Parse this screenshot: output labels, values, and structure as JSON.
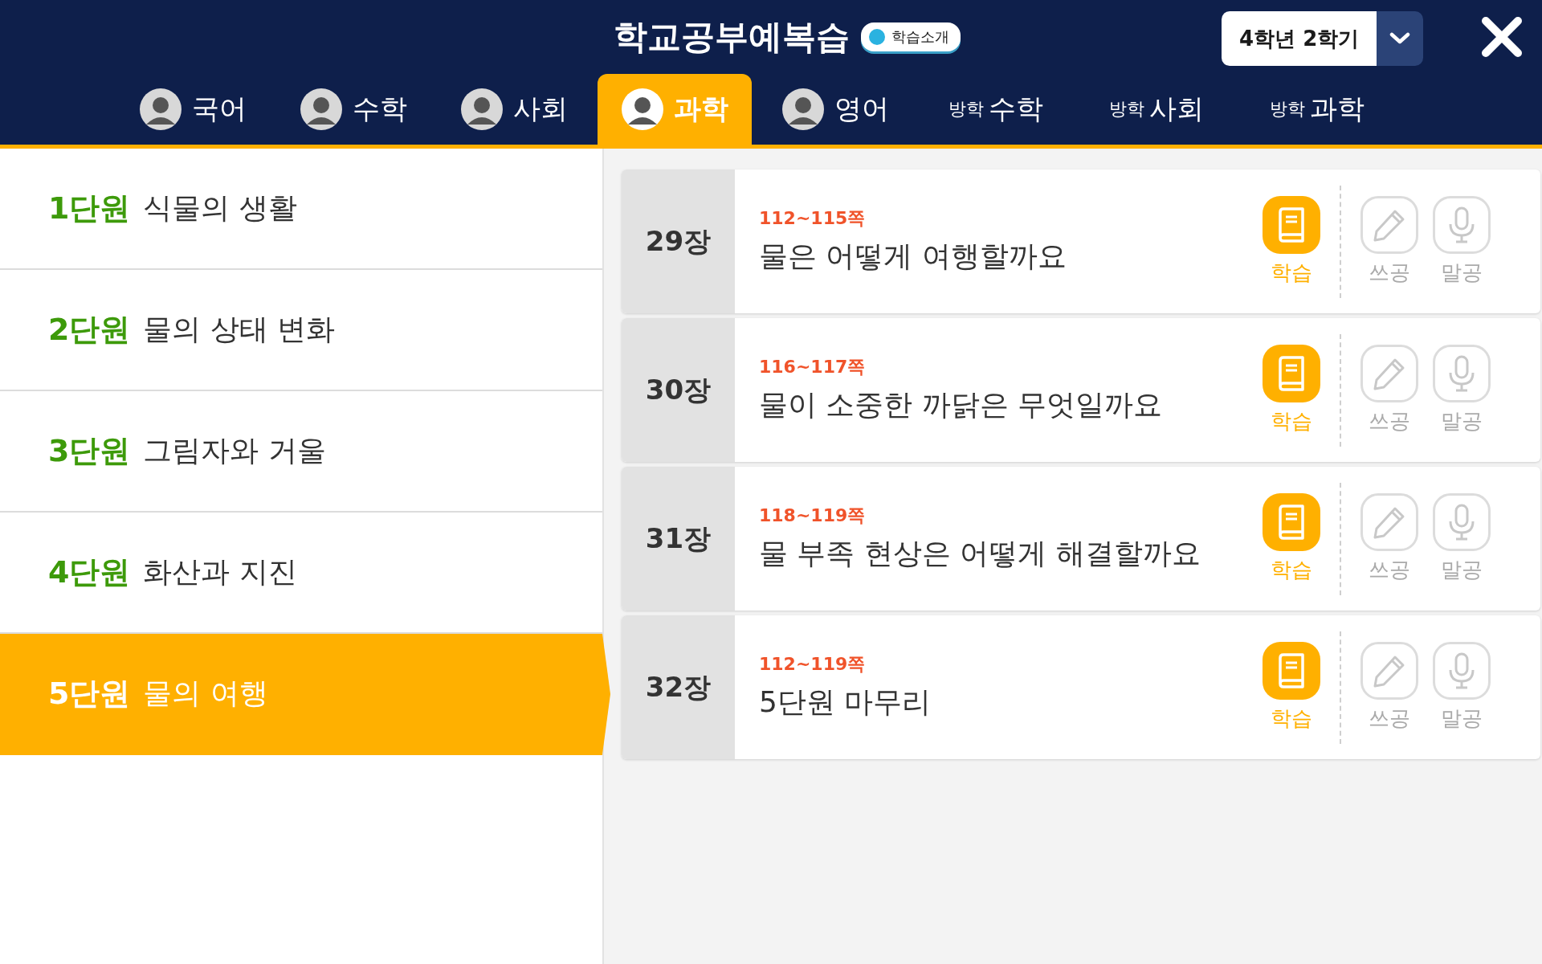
{
  "header": {
    "title": "학교공부예복습",
    "intro_button": "학습소개",
    "semester": "4학년 2학기"
  },
  "tabs": [
    {
      "label": "국어",
      "avatar": true,
      "selected": false
    },
    {
      "label": "수학",
      "avatar": true,
      "selected": false
    },
    {
      "label": "사회",
      "avatar": true,
      "selected": false
    },
    {
      "label": "과학",
      "avatar": true,
      "selected": true
    },
    {
      "label": "영어",
      "avatar": true,
      "selected": false
    },
    {
      "prefix": "방학",
      "label": "수학",
      "avatar": false,
      "selected": false
    },
    {
      "prefix": "방학",
      "label": "사회",
      "avatar": false,
      "selected": false
    },
    {
      "prefix": "방학",
      "label": "과학",
      "avatar": false,
      "selected": false
    }
  ],
  "units": [
    {
      "number": "1단원",
      "title": "식물의 생활",
      "selected": false
    },
    {
      "number": "2단원",
      "title": "물의 상태 변화",
      "selected": false
    },
    {
      "number": "3단원",
      "title": "그림자와 거울",
      "selected": false
    },
    {
      "number": "4단원",
      "title": "화산과 지진",
      "selected": false
    },
    {
      "number": "5단원",
      "title": "물의 여행",
      "selected": true
    }
  ],
  "lessons": [
    {
      "chapter": "29장",
      "pages": "112~115쪽",
      "title": "물은 어떻게 여행할까요",
      "actions": [
        {
          "kind": "book",
          "label": "학습",
          "enabled": true
        },
        {
          "kind": "pencil",
          "label": "쓰공",
          "enabled": false
        },
        {
          "kind": "mic",
          "label": "말공",
          "enabled": false
        }
      ]
    },
    {
      "chapter": "30장",
      "pages": "116~117쪽",
      "title": "물이 소중한 까닭은 무엇일까요",
      "actions": [
        {
          "kind": "book",
          "label": "학습",
          "enabled": true
        },
        {
          "kind": "pencil",
          "label": "쓰공",
          "enabled": false
        },
        {
          "kind": "mic",
          "label": "말공",
          "enabled": false
        }
      ]
    },
    {
      "chapter": "31장",
      "pages": "118~119쪽",
      "title": "물 부족 현상은 어떻게 해결할까요",
      "actions": [
        {
          "kind": "book",
          "label": "학습",
          "enabled": true
        },
        {
          "kind": "pencil",
          "label": "쓰공",
          "enabled": false
        },
        {
          "kind": "mic",
          "label": "말공",
          "enabled": false
        }
      ]
    },
    {
      "chapter": "32장",
      "pages": "112~119쪽",
      "title": "5단원 마무리",
      "actions": [
        {
          "kind": "book",
          "label": "학습",
          "enabled": true
        },
        {
          "kind": "pencil",
          "label": "쓰공",
          "enabled": false
        },
        {
          "kind": "mic",
          "label": "말공",
          "enabled": false
        }
      ]
    }
  ]
}
